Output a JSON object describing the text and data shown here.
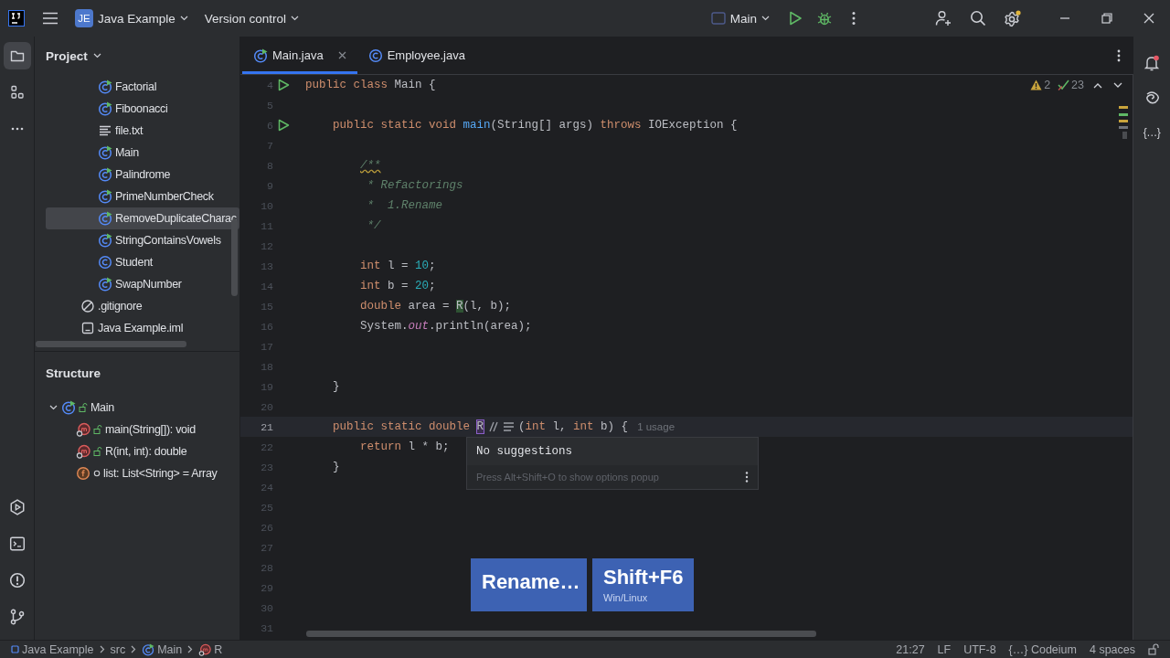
{
  "title_bar": {
    "project_badge": "JE",
    "project": "Java Example",
    "vcs": "Version control",
    "run_config": "Main"
  },
  "left_toolbar": {
    "top": [
      {
        "kind": "project",
        "selected": true
      },
      {
        "kind": "structure",
        "selected": false
      },
      {
        "kind": "more",
        "selected": false
      }
    ],
    "bottom": [
      {
        "kind": "run"
      },
      {
        "kind": "terminal"
      },
      {
        "kind": "problems"
      },
      {
        "kind": "git"
      }
    ]
  },
  "project_panel": {
    "title": "Project",
    "tree": [
      {
        "children": [
          {
            "label": "Factorial",
            "kind": "runnable-class",
            "selected": false
          },
          {
            "label": "Fiboonacci",
            "kind": "runnable-class",
            "selected": false
          },
          {
            "label": "file.txt",
            "kind": "text",
            "selected": false
          },
          {
            "label": "Main",
            "kind": "runnable-class",
            "selected": false
          },
          {
            "label": "Palindrome",
            "kind": "runnable-class",
            "selected": false
          },
          {
            "label": "PrimeNumberCheck",
            "kind": "runnable-class",
            "selected": false
          },
          {
            "label": "RemoveDuplicateCharac",
            "kind": "runnable-class",
            "selected": true
          },
          {
            "label": "StringContainsVowels",
            "kind": "runnable-class",
            "selected": false
          },
          {
            "label": "Student",
            "kind": "class",
            "selected": false
          },
          {
            "label": "SwapNumber",
            "kind": "runnable-class",
            "selected": false
          }
        ]
      },
      {
        "label": ".gitignore",
        "kind": "ignore",
        "selected": false
      },
      {
        "label": "Java Example.iml",
        "kind": "module",
        "selected": false
      }
    ]
  },
  "structure_panel": {
    "title": "Structure",
    "tree": [
      {
        "label": "Main",
        "kind": "public-class",
        "expanded": true,
        "children": [
          {
            "label": "main(String[]): void",
            "kind": "public-method"
          },
          {
            "label": "R(int, int): double",
            "kind": "public-method"
          },
          {
            "label": "list: List<String> = Array",
            "kind": "package-field"
          }
        ]
      }
    ]
  },
  "tabs": [
    {
      "label": "Main.java",
      "kind": "runnable-class",
      "selected": true,
      "closable": true
    },
    {
      "label": "Employee.java",
      "kind": "class",
      "selected": false,
      "closable": false
    }
  ],
  "inspections": {
    "warnings": "2",
    "typos": "23"
  },
  "editor": {
    "lines": [
      {
        "number": "4",
        "run": true,
        "current": false,
        "tokens": [
          {
            "kind": "keyword",
            "text": "public class "
          },
          {
            "kind": "plain",
            "text": "Main {"
          }
        ]
      },
      {
        "number": "5",
        "run": false,
        "current": false
      },
      {
        "number": "6",
        "run": true,
        "current": false,
        "tokens": [
          {
            "kind": "keyword",
            "text": "    public static void "
          },
          {
            "kind": "method",
            "text": "main"
          },
          {
            "kind": "plain",
            "text": "(String[] args) "
          },
          {
            "kind": "keyword",
            "text": "throws "
          },
          {
            "kind": "plain",
            "text": "IOException {"
          }
        ]
      },
      {
        "number": "7",
        "run": false,
        "current": false
      },
      {
        "number": "8",
        "run": false,
        "current": false,
        "tokens": [
          {
            "kind": "comment-warning",
            "text": "        /**"
          }
        ]
      },
      {
        "number": "9",
        "run": false,
        "current": false,
        "tokens": [
          {
            "kind": "comment",
            "text": "         * Refactorings"
          }
        ]
      },
      {
        "number": "10",
        "run": false,
        "current": false,
        "tokens": [
          {
            "kind": "comment",
            "text": "         *  1.Rename"
          }
        ]
      },
      {
        "number": "11",
        "run": false,
        "current": false,
        "tokens": [
          {
            "kind": "comment",
            "text": "         */"
          }
        ]
      },
      {
        "number": "12",
        "run": false,
        "current": false
      },
      {
        "number": "13",
        "run": false,
        "current": false,
        "tokens": [
          {
            "kind": "keyword",
            "text": "        int "
          },
          {
            "kind": "plain",
            "text": "l = "
          },
          {
            "kind": "number",
            "text": "10"
          },
          {
            "kind": "plain",
            "text": ";"
          }
        ]
      },
      {
        "number": "14",
        "run": false,
        "current": false,
        "tokens": [
          {
            "kind": "keyword",
            "text": "        int "
          },
          {
            "kind": "plain",
            "text": "b = "
          },
          {
            "kind": "number",
            "text": "20"
          },
          {
            "kind": "plain",
            "text": ";"
          }
        ]
      },
      {
        "number": "15",
        "run": false,
        "current": false,
        "tokens": [
          {
            "kind": "keyword",
            "text": "        double "
          },
          {
            "kind": "plain",
            "text": "area = "
          },
          {
            "kind": "match",
            "text": "R"
          },
          {
            "kind": "plain",
            "text": "(l, b);"
          }
        ]
      },
      {
        "number": "16",
        "run": false,
        "current": false,
        "tokens": [
          {
            "kind": "plain",
            "text": "        System."
          },
          {
            "kind": "static-field",
            "text": "out"
          },
          {
            "kind": "plain",
            "text": ".println(area);"
          }
        ]
      },
      {
        "number": "17",
        "run": false,
        "current": false
      },
      {
        "number": "18",
        "run": false,
        "current": false
      },
      {
        "number": "19",
        "run": false,
        "current": false,
        "tokens": [
          {
            "kind": "plain",
            "text": "    }"
          }
        ]
      },
      {
        "number": "20",
        "run": false,
        "current": false
      },
      {
        "number": "21",
        "run": false,
        "current": true,
        "tokens": [
          {
            "kind": "keyword",
            "text": "    public static double "
          },
          {
            "kind": "caret-symbol",
            "text": "R"
          },
          {
            "kind": "inline-hint"
          },
          {
            "kind": "plain",
            "text": "("
          },
          {
            "kind": "keyword",
            "text": "int "
          },
          {
            "kind": "plain",
            "text": "l, "
          },
          {
            "kind": "keyword",
            "text": "int "
          },
          {
            "kind": "plain",
            "text": "b) {"
          },
          {
            "kind": "usage",
            "text": "1 usage"
          }
        ]
      },
      {
        "number": "22",
        "run": false,
        "current": false,
        "tokens": [
          {
            "kind": "keyword",
            "text": "        return "
          },
          {
            "kind": "plain",
            "text": "l * b;"
          }
        ]
      },
      {
        "number": "23",
        "run": false,
        "current": false,
        "tokens": [
          {
            "kind": "plain",
            "text": "    }"
          }
        ]
      },
      {
        "number": "24",
        "run": false,
        "current": false
      },
      {
        "number": "25",
        "run": false,
        "current": false
      },
      {
        "number": "26",
        "run": false,
        "current": false
      },
      {
        "number": "27",
        "run": false,
        "current": false
      },
      {
        "number": "28",
        "run": false,
        "current": false
      },
      {
        "number": "29",
        "run": false,
        "current": false
      },
      {
        "number": "30",
        "run": false,
        "current": false
      },
      {
        "number": "31",
        "run": false,
        "current": false
      }
    ]
  },
  "popup": {
    "message": "No suggestions",
    "hint": "Press Alt+Shift+O to show options popup"
  },
  "keystroke_overlay": {
    "action": "Rename…",
    "shortcut": "Shift+F6",
    "platform": "Win/Linux"
  },
  "right_toolbar": {
    "codeium_chat": "{…}"
  },
  "status_bar": {
    "breadcrumbs": [
      {
        "label": "Java Example",
        "kind": "module"
      },
      {
        "label": "src"
      },
      {
        "label": "Main",
        "kind": "runnable-class"
      },
      {
        "label": "R",
        "kind": "method"
      }
    ],
    "position": "21:27",
    "line_separator": "LF",
    "encoding": "UTF-8",
    "plugin": "{…} Codeium",
    "indent": "4 spaces"
  }
}
